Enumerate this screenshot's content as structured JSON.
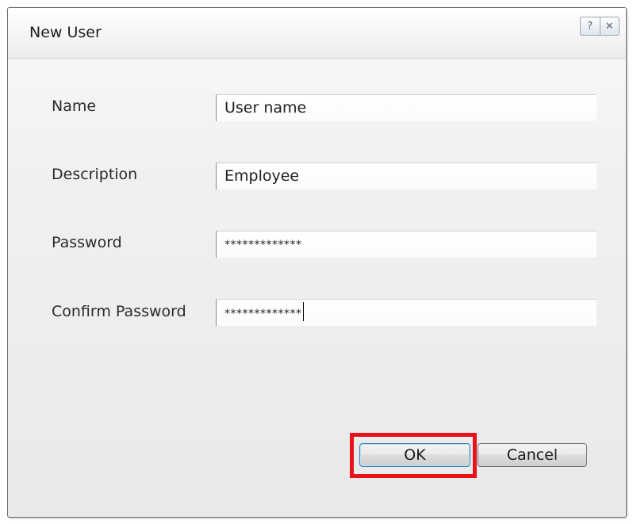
{
  "dialog": {
    "title": "New User",
    "help_label": "?",
    "close_label": "✕"
  },
  "form": {
    "name_label": "Name",
    "name_value": "User name",
    "description_label": "Description",
    "description_value": "Employee",
    "password_label": "Password",
    "password_value": "*************",
    "confirm_password_label": "Confirm Password",
    "confirm_password_value": "*************"
  },
  "buttons": {
    "ok_label": "OK",
    "cancel_label": "Cancel"
  },
  "annotation": {
    "highlight_color": "#e8121a"
  }
}
